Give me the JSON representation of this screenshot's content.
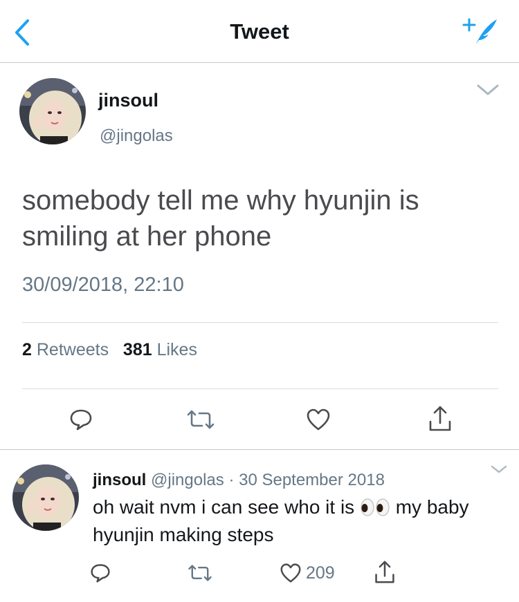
{
  "header": {
    "title": "Tweet",
    "accent_color": "#1da1f2"
  },
  "tweet": {
    "author_name": "jinsoul",
    "author_handle": "@jingolas",
    "text": "somebody tell me why hyunjin is smiling at her phone",
    "timestamp": "30/09/2018, 22:10",
    "retweets_count": "2",
    "retweets_label": "Retweets",
    "likes_count": "381",
    "likes_label": "Likes"
  },
  "reply": {
    "author_name": "jinsoul",
    "author_handle": "@jingolas",
    "separator": "·",
    "date": "30 September 2018",
    "text_before": "oh wait nvm i can see who it is",
    "text_after": "my baby hyunjin making steps",
    "like_count": "209"
  }
}
